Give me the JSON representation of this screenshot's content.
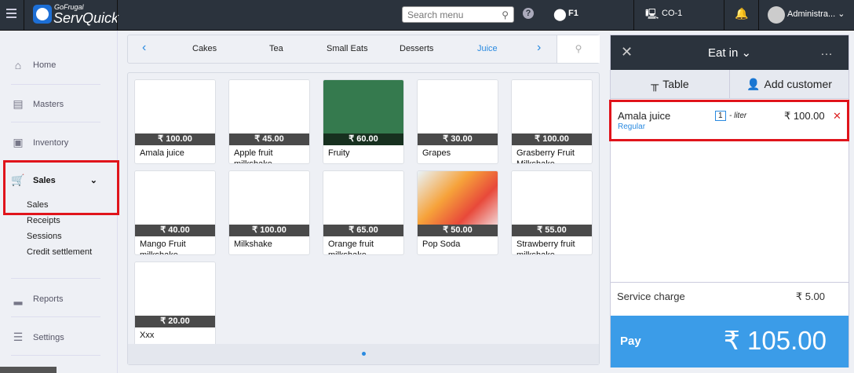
{
  "header": {
    "brand_top": "GoFrugal",
    "brand": "ServQuick",
    "search_placeholder": "Search menu",
    "location": "F1",
    "counter": "CO-1",
    "user": "Administra..."
  },
  "sidebar": {
    "items": [
      {
        "label": "Home",
        "icon": "home-icon"
      },
      {
        "label": "Masters",
        "icon": "masters-icon"
      },
      {
        "label": "Inventory",
        "icon": "inventory-icon"
      },
      {
        "label": "Sales",
        "icon": "cart-icon"
      },
      {
        "label": "Reports",
        "icon": "reports-icon"
      },
      {
        "label": "Settings",
        "icon": "settings-icon"
      }
    ],
    "sales_sub": [
      "Sales",
      "Receipts",
      "Sessions",
      "Credit settlement"
    ]
  },
  "categories": [
    "Cakes",
    "Tea",
    "Small Eats",
    "Desserts",
    "Juice"
  ],
  "active_category": "Juice",
  "products": [
    {
      "name": "Amala juice",
      "price": "₹ 100.00"
    },
    {
      "name": "Apple fruit milkshake",
      "price": "₹ 45.00"
    },
    {
      "name": "Fruity",
      "price": "₹ 60.00",
      "color": "#357a4e"
    },
    {
      "name": "Grapes",
      "price": "₹ 30.00"
    },
    {
      "name": "Grasberry Fruit Milkshake",
      "price": "₹ 100.00"
    },
    {
      "name": "Mango Fruit milkshake",
      "price": "₹ 40.00"
    },
    {
      "name": "Milkshake",
      "price": "₹ 100.00"
    },
    {
      "name": "Orange fruit milkshake",
      "price": "₹ 65.00"
    },
    {
      "name": "Pop Soda",
      "price": "₹ 50.00",
      "image": true
    },
    {
      "name": "Strawberry fruit milkshake",
      "price": "₹ 55.00"
    },
    {
      "name": "Xxx",
      "price": "₹ 20.00"
    }
  ],
  "order": {
    "mode": "Eat in",
    "table": "Table",
    "add_customer": "Add customer",
    "items": [
      {
        "name": "Amala juice",
        "variant": "Regular",
        "qty": "1",
        "unit": "- liter",
        "amount": "₹ 100.00"
      }
    ],
    "service_charge_label": "Service charge",
    "service_charge": "₹ 5.00",
    "pay_label": "Pay",
    "total": "₹ 105.00"
  }
}
